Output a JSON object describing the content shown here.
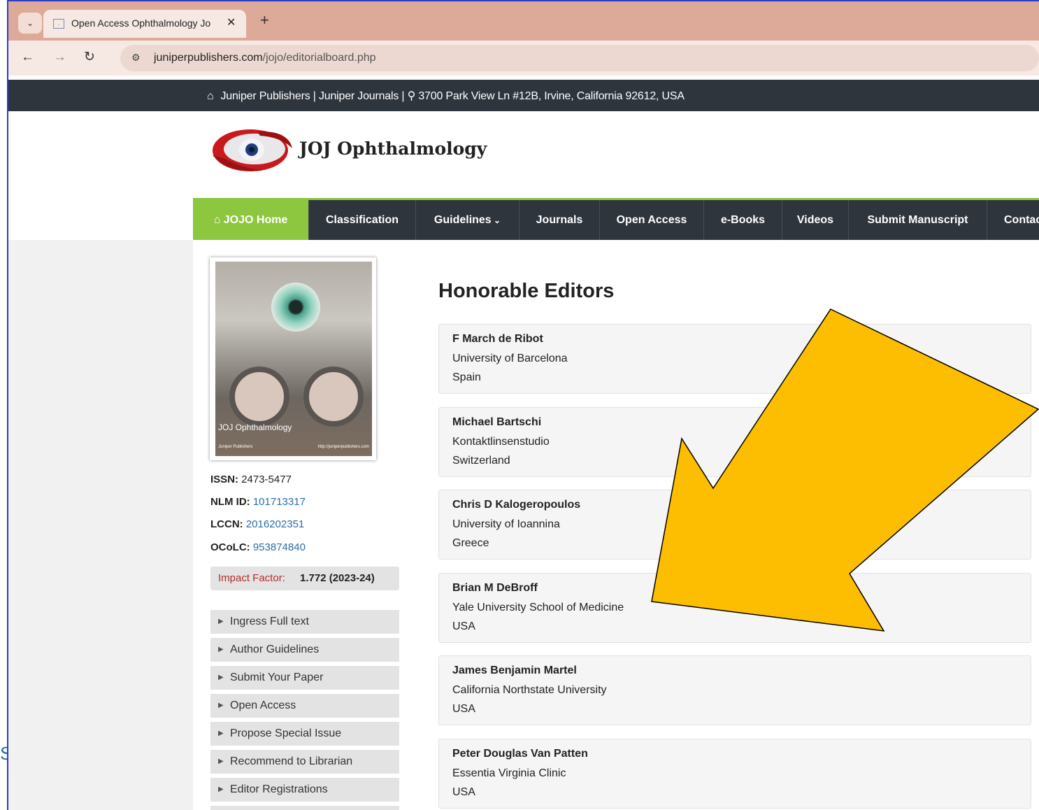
{
  "browser": {
    "tab_title": "Open Access Ophthalmology Jo",
    "url_domain": "juniperpublishers.com",
    "url_path": "/jojo/editorialboard.php"
  },
  "topstrip": {
    "text": "Juniper Publishers | Juniper Journals | ",
    "address": "3700 Park View Ln #12B, Irvine, California 92612, USA"
  },
  "logo": {
    "title": "JOJ Ophthalmology"
  },
  "nav": {
    "items": [
      "JOJO Home",
      "Classification",
      "Guidelines",
      "Journals",
      "Open Access",
      "e-Books",
      "Videos",
      "Submit Manuscript",
      "Contac"
    ]
  },
  "cover": {
    "title": "JOJ Ophthalmology",
    "publisher": "Juniper Publishers",
    "site": "http://juniperpublishers.com"
  },
  "meta": {
    "issn_label": "ISSN:",
    "issn": "2473-5477",
    "nlm_label": "NLM ID:",
    "nlm": "101713317",
    "lccn_label": "LCCN:",
    "lccn": "2016202351",
    "oclc_label": "OCoLC:",
    "oclc": "953874840",
    "impact_label": "Impact Factor:",
    "impact": "1.772 (2023-24)"
  },
  "sidebar_links": [
    "Ingress Full text",
    "Author Guidelines",
    "Submit Your Paper",
    "Open Access",
    "Propose Special Issue",
    "Recommend to Librarian",
    "Editor Registrations"
  ],
  "main": {
    "heading": "Honorable Editors",
    "editors": [
      {
        "name": "F March de Ribot",
        "affiliation": "University of Barcelona",
        "country": "Spain"
      },
      {
        "name": "Michael Bartschi",
        "affiliation": "Kontaktlinsenstudio",
        "country": "Switzerland"
      },
      {
        "name": "Chris D Kalogeropoulos",
        "affiliation": "University of Ioannina",
        "country": "Greece"
      },
      {
        "name": "Brian M DeBroff",
        "affiliation": "Yale University School of Medicine",
        "country": "USA"
      },
      {
        "name": "James Benjamin Martel",
        "affiliation": "California Northstate University",
        "country": "USA"
      },
      {
        "name": "Peter Douglas Van Patten",
        "affiliation": "Essentia Virginia Clinic",
        "country": "USA"
      }
    ]
  },
  "overlay": {
    "arrow_color": "#fdbd00"
  },
  "stray_text": "S"
}
